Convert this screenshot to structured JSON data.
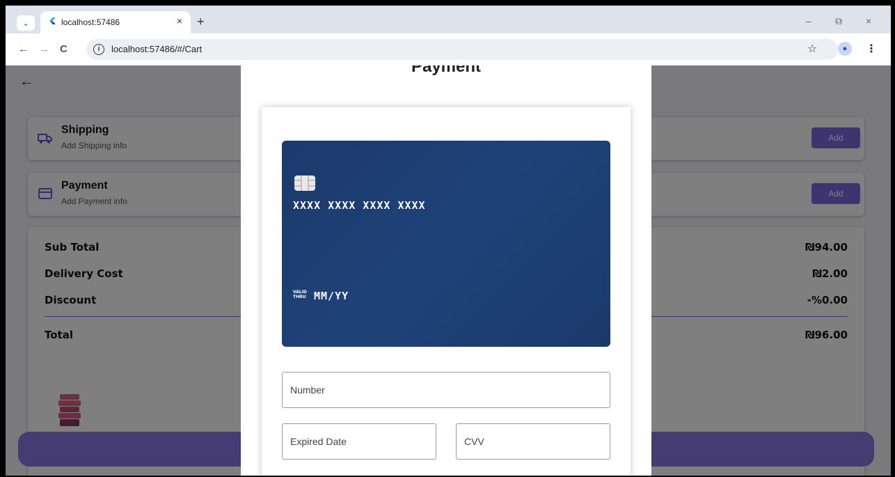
{
  "browser": {
    "tab_title": "localhost:57486",
    "url": "localhost:57486/#/Cart",
    "close_tab": "×",
    "new_tab": "+",
    "minimize": "–",
    "restore": "⧉",
    "close_window": "×"
  },
  "shipping": {
    "title": "Shipping",
    "subtitle": "Add Shipping info",
    "add_label": "Add",
    "icon": "truck-icon"
  },
  "payment_card": {
    "title": "Payment",
    "subtitle": "Add Payment info",
    "add_label": "Add",
    "icon": "credit-card-icon"
  },
  "summary": {
    "rows": [
      {
        "label": "Sub Total",
        "value": "₪94.00"
      },
      {
        "label": "Delivery Cost",
        "value": "₪2.00"
      },
      {
        "label": "Discount",
        "value": "-%0.00"
      }
    ],
    "total_label": "Total",
    "total_value": "₪96.00"
  },
  "modal": {
    "title": "Payment",
    "card_number": "XXXX XXXX XXXX XXXX",
    "valid_thru_line1": "VALID",
    "valid_thru_line2": "THRU",
    "expiry": "MM/YY",
    "fields": {
      "number_label": "Number",
      "expired_label": "Expired Date",
      "cvv_label": "CVV"
    }
  },
  "colors": {
    "accent": "#7d68e0",
    "card_blue": "#1c3a6c"
  }
}
